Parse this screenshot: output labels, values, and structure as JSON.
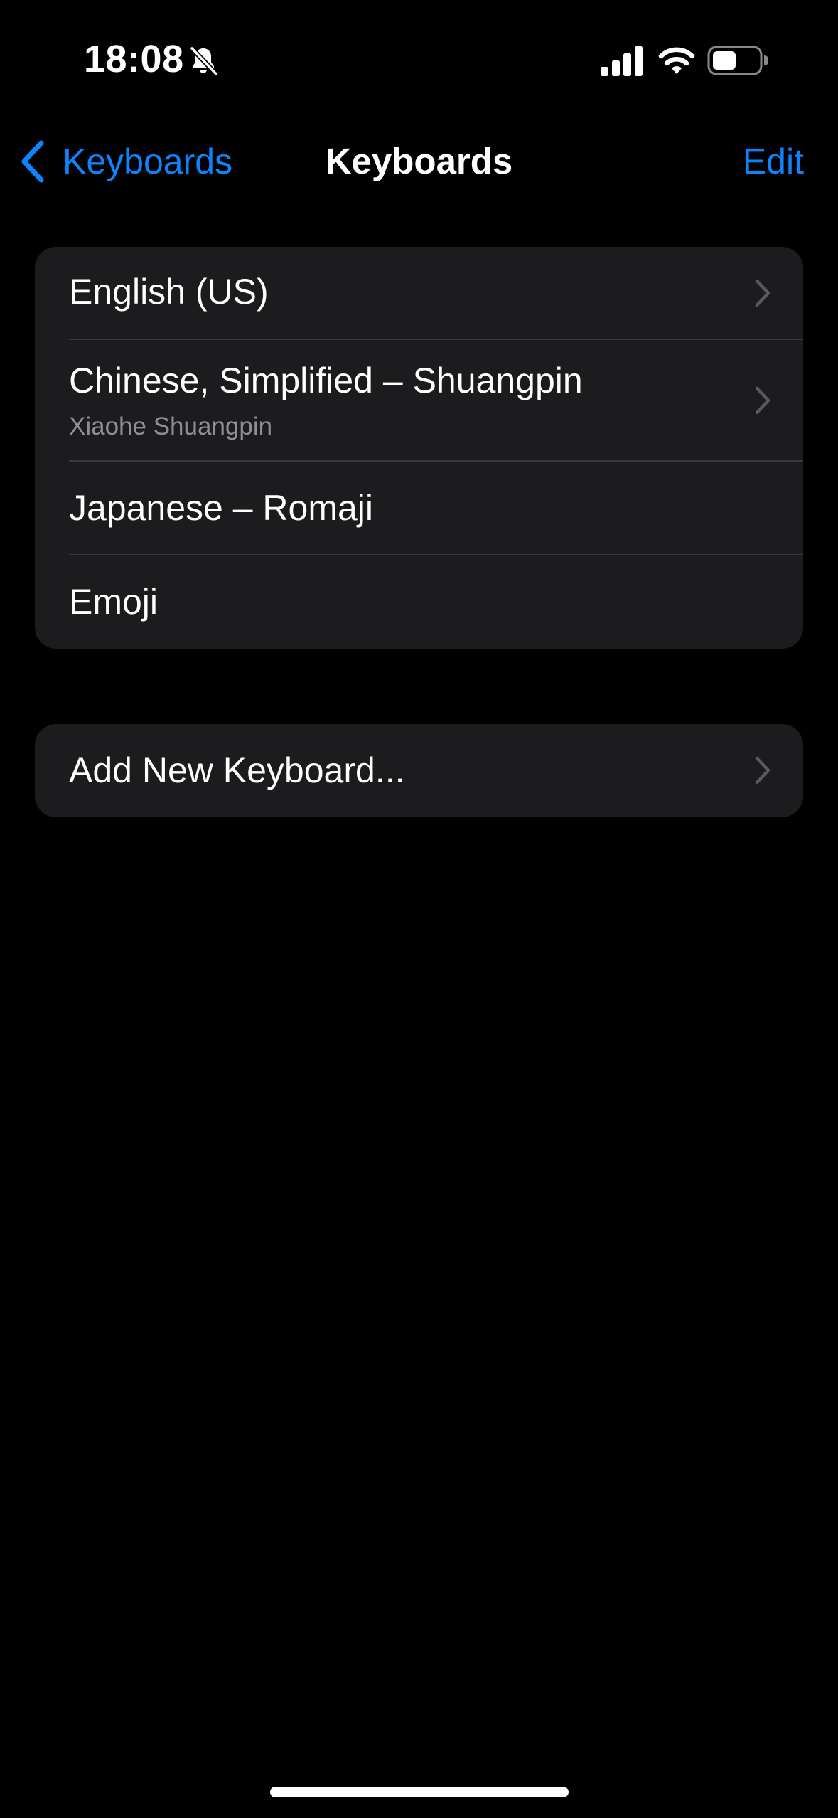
{
  "status_bar": {
    "time": "18:08",
    "icons": [
      "bell-slash-icon",
      "cellular-signal-icon",
      "wifi-icon",
      "battery-icon"
    ]
  },
  "nav": {
    "back_label": "Keyboards",
    "title": "Keyboards",
    "edit_label": "Edit"
  },
  "keyboards": [
    {
      "label": "English (US)",
      "sublabel": "",
      "chevron": true
    },
    {
      "label": "Chinese, Simplified – Shuangpin",
      "sublabel": "Xiaohe Shuangpin",
      "chevron": true
    },
    {
      "label": "Japanese – Romaji",
      "sublabel": "",
      "chevron": false
    },
    {
      "label": "Emoji",
      "sublabel": "",
      "chevron": false
    }
  ],
  "add_keyboard": {
    "label": "Add New Keyboard..."
  },
  "colors": {
    "background": "#000000",
    "cell": "#1c1c1e",
    "accent": "#0a84ff",
    "separator": "#38383a",
    "secondary_text": "#8e8e93",
    "chevron": "#5a5a5e"
  }
}
